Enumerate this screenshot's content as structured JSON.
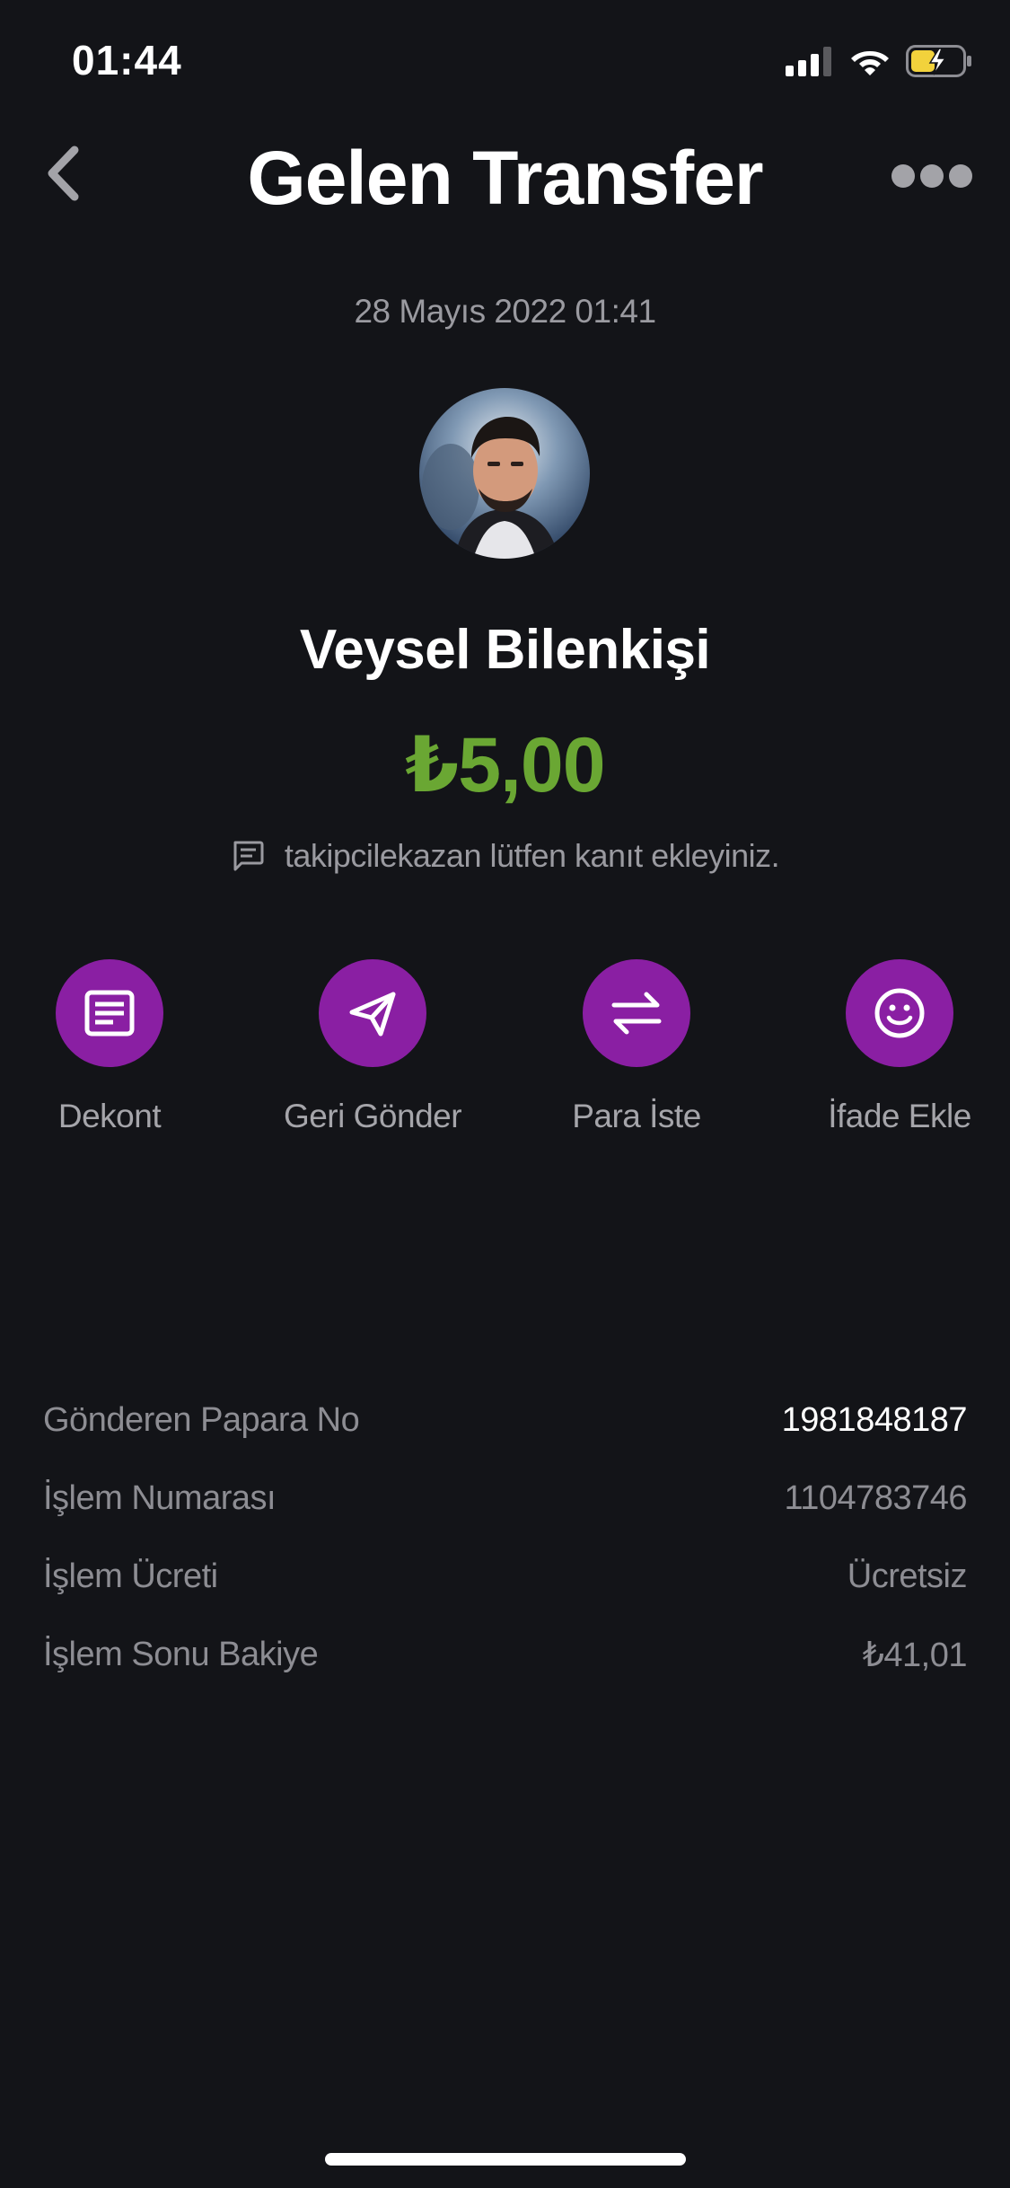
{
  "status_bar": {
    "time": "01:44"
  },
  "nav": {
    "title": "Gelen Transfer"
  },
  "transaction": {
    "date": "28 Mayıs 2022 01:41",
    "sender_name": "Veysel Bilenkişi",
    "amount": "₺5,00",
    "note": "takipcilekazan lütfen kanıt ekleyiniz."
  },
  "actions": [
    {
      "label": "Dekont",
      "icon": "receipt-icon"
    },
    {
      "label": "Geri Gönder",
      "icon": "send-icon"
    },
    {
      "label": "Para İste",
      "icon": "swap-arrows-icon"
    },
    {
      "label": "İfade Ekle",
      "icon": "smiley-icon"
    }
  ],
  "details": [
    {
      "label": "Gönderen Papara No",
      "value": "1981848187"
    },
    {
      "label": "İşlem Numarası",
      "value": "1104783746"
    },
    {
      "label": "İşlem Ücreti",
      "value": "Ücretsiz"
    },
    {
      "label": "İşlem Sonu Bakiye",
      "value": "₺41,01"
    }
  ],
  "colors": {
    "background": "#131418",
    "accent_purple": "#8a1fa3",
    "amount_green": "#6aa733",
    "muted_text": "#9a9aa0",
    "battery_yellow": "#f2d23c"
  }
}
